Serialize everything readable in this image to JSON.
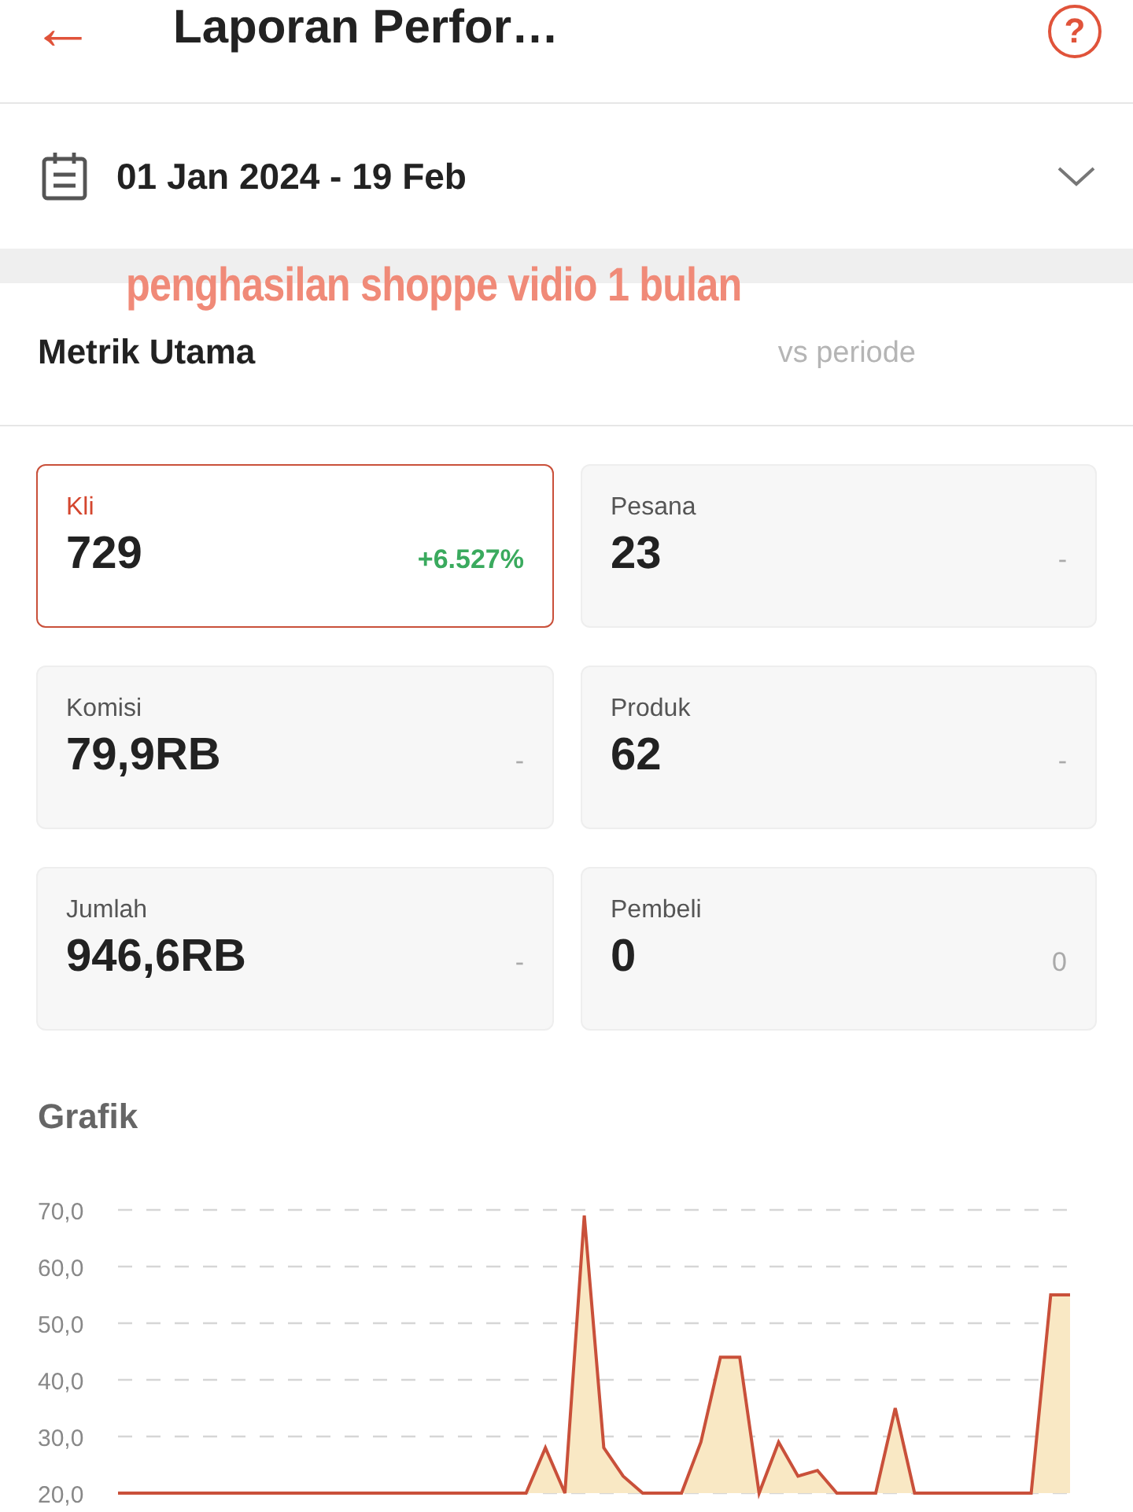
{
  "header": {
    "back_icon": "←",
    "title": "Laporan Perfor…",
    "help_icon": "?"
  },
  "date_filter": {
    "value": "01 Jan 2024 - 19 Feb"
  },
  "caption": "penghasilan shoppe vidio 1 bulan",
  "metrics_section": {
    "title": "Metrik Utama",
    "compare_label": "vs periode"
  },
  "metrics": [
    {
      "label": "Kli",
      "value": "729",
      "change": "+6.527%",
      "positive": true,
      "selected": true
    },
    {
      "label": "Pesana",
      "value": "23",
      "change": "-",
      "positive": false,
      "selected": false
    },
    {
      "label": "Komisi",
      "value": "79,9RB",
      "change": "-",
      "positive": false,
      "selected": false
    },
    {
      "label": "Produk",
      "value": "62",
      "change": "-",
      "positive": false,
      "selected": false
    },
    {
      "label": "Jumlah",
      "value": "946,6RB",
      "change": "-",
      "positive": false,
      "selected": false
    },
    {
      "label": "Pembeli",
      "value": "0",
      "change": "0",
      "positive": false,
      "selected": false
    }
  ],
  "chart": {
    "title": "Grafik",
    "chart_data": {
      "type": "area",
      "yticks": [
        {
          "value": 20,
          "label": "20,0"
        },
        {
          "value": 30,
          "label": "30,0"
        },
        {
          "value": 40,
          "label": "40,0"
        },
        {
          "value": 50,
          "label": "50,0"
        },
        {
          "value": 60,
          "label": "60,0"
        },
        {
          "value": 70,
          "label": "70,0"
        }
      ],
      "ylim": [
        20,
        70
      ],
      "grid": true,
      "series": [
        {
          "color": "#c9503a",
          "values": [
            20,
            20,
            20,
            20,
            20,
            20,
            20,
            20,
            20,
            20,
            20,
            20,
            20,
            20,
            20,
            20,
            20,
            20,
            20,
            20,
            20,
            20,
            28,
            20,
            69,
            28,
            23,
            20,
            20,
            20,
            29,
            44,
            44,
            20,
            29,
            23,
            24,
            20,
            20,
            20,
            35,
            20,
            20,
            20,
            20,
            20,
            20,
            20,
            55,
            55
          ]
        }
      ]
    }
  }
}
